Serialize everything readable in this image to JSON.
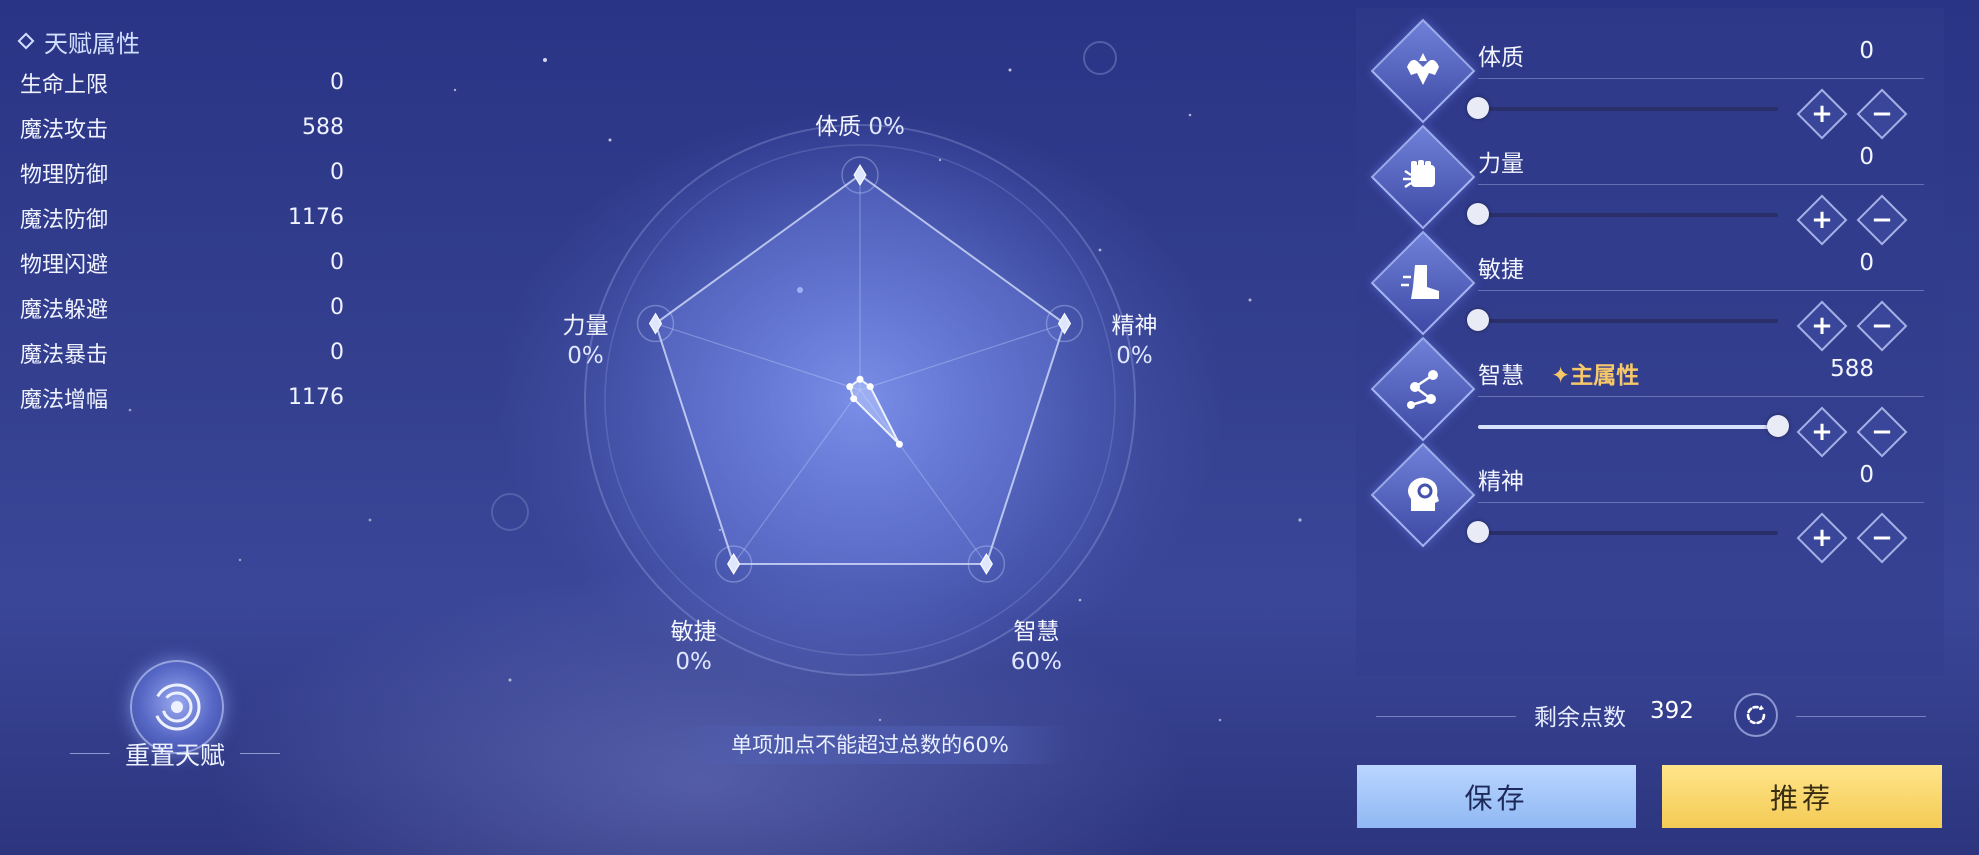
{
  "stats": {
    "title": "天赋属性",
    "rows": [
      {
        "label": "生命上限",
        "value": "0"
      },
      {
        "label": "魔法攻击",
        "value": "588"
      },
      {
        "label": "物理防御",
        "value": "0"
      },
      {
        "label": "魔法防御",
        "value": "1176"
      },
      {
        "label": "物理闪避",
        "value": "0"
      },
      {
        "label": "魔法躲避",
        "value": "0"
      },
      {
        "label": "魔法暴击",
        "value": "0"
      },
      {
        "label": "魔法增幅",
        "value": "1176"
      }
    ]
  },
  "reset": {
    "label": "重置天赋",
    "icon": "swirl-icon"
  },
  "radar": {
    "axes": [
      {
        "name": "体质",
        "pct": "0%",
        "fraction": 0.0
      },
      {
        "name": "精神",
        "pct": "0%",
        "fraction": 0.0
      },
      {
        "name": "智慧",
        "pct": "60%",
        "fraction": 0.6
      },
      {
        "name": "敏捷",
        "pct": "0%",
        "fraction": 0.0
      },
      {
        "name": "力量",
        "pct": "0%",
        "fraction": 0.0
      }
    ],
    "note": "单项加点不能超过总数的60%"
  },
  "attributes": [
    {
      "name": "体质",
      "value": "0",
      "fraction": 0.0,
      "icon": "muscle-icon",
      "tag": ""
    },
    {
      "name": "力量",
      "value": "0",
      "fraction": 0.0,
      "icon": "fist-icon",
      "tag": ""
    },
    {
      "name": "敏捷",
      "value": "0",
      "fraction": 0.0,
      "icon": "boot-icon",
      "tag": ""
    },
    {
      "name": "智慧",
      "value": "588",
      "fraction": 1.0,
      "icon": "nodes-icon",
      "tag": "✦主属性"
    },
    {
      "name": "精神",
      "value": "0",
      "fraction": 0.0,
      "icon": "head-icon",
      "tag": ""
    }
  ],
  "stepper": {
    "minus": "−",
    "plus": "+"
  },
  "remaining": {
    "label": "剩余点数",
    "value": "392"
  },
  "buttons": {
    "save": "保存",
    "recommend": "推荐"
  },
  "colors": {
    "accent_gold": "#f6c86a",
    "save_bg": "#a8c8fb",
    "recommend_bg": "#f8d66a"
  }
}
